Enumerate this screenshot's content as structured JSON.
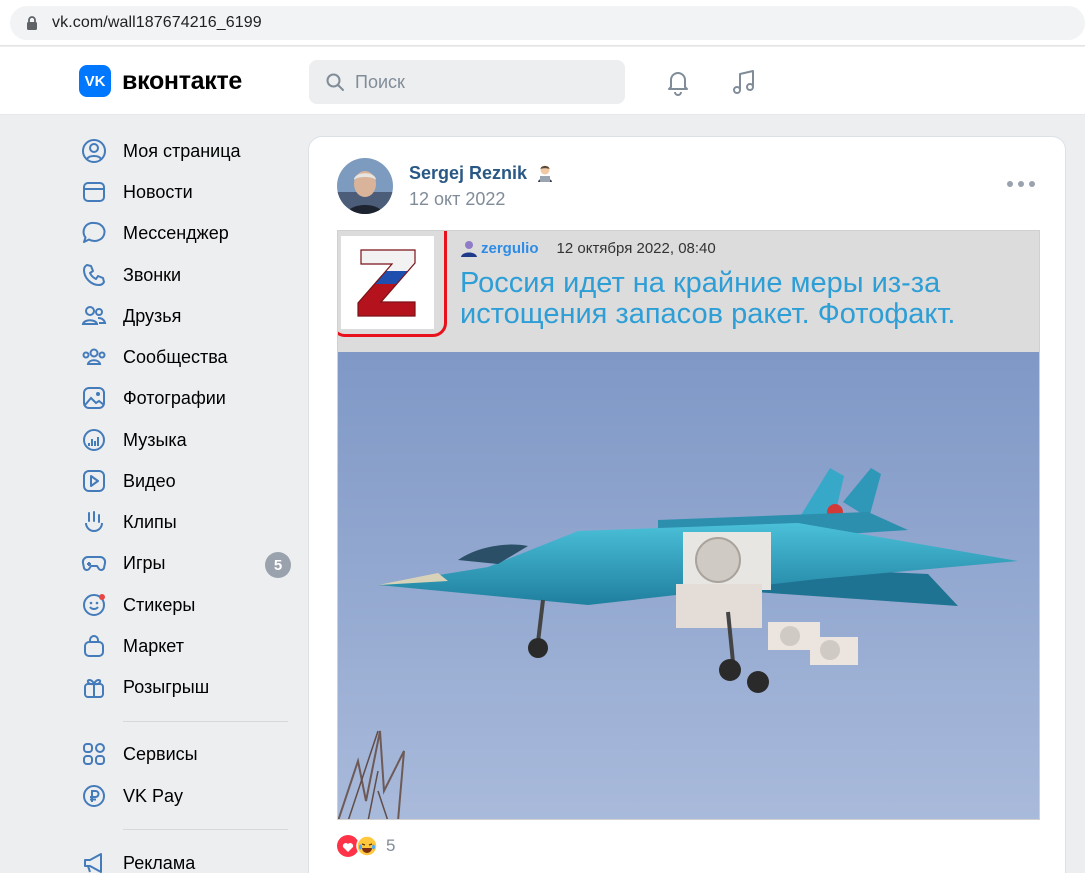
{
  "browser": {
    "url": "vk.com/wall187674216_6199"
  },
  "header": {
    "logo_badge": "VK",
    "logo_text": "вконтакте",
    "search_placeholder": "Поиск"
  },
  "sidebar": {
    "items": [
      {
        "label": "Моя страница",
        "icon": "user-circle-icon"
      },
      {
        "label": "Новости",
        "icon": "news-icon"
      },
      {
        "label": "Мессенджер",
        "icon": "message-icon"
      },
      {
        "label": "Звонки",
        "icon": "phone-icon"
      },
      {
        "label": "Друзья",
        "icon": "friends-icon"
      },
      {
        "label": "Сообщества",
        "icon": "communities-icon"
      },
      {
        "label": "Фотографии",
        "icon": "photo-icon"
      },
      {
        "label": "Музыка",
        "icon": "music-icon"
      },
      {
        "label": "Видео",
        "icon": "video-icon"
      },
      {
        "label": "Клипы",
        "icon": "clips-icon"
      },
      {
        "label": "Игры",
        "icon": "gamepad-icon",
        "badge": "5"
      },
      {
        "label": "Стикеры",
        "icon": "sticker-icon"
      },
      {
        "label": "Маркет",
        "icon": "market-icon"
      },
      {
        "label": "Розыгрыш",
        "icon": "gift-icon"
      },
      {
        "label": "Сервисы",
        "icon": "services-icon"
      },
      {
        "label": "VK Pay",
        "icon": "ruble-icon"
      },
      {
        "label": "Реклама",
        "icon": "megaphone-icon"
      }
    ]
  },
  "post": {
    "author": "Sergej Reznik",
    "date": "12 окт 2022",
    "repost": {
      "user": "zergulio",
      "datetime": "12 октября 2022, 08:40",
      "headline": "Россия идет на крайние меры из-за истощения запасов ракет. Фотофакт.",
      "logo_letter": "Z"
    },
    "reactions_count": "5"
  },
  "colors": {
    "vk_blue": "#0077ff",
    "link": "#2a5885",
    "headline": "#2e9ed6",
    "highlight_frame": "#e8121c"
  }
}
